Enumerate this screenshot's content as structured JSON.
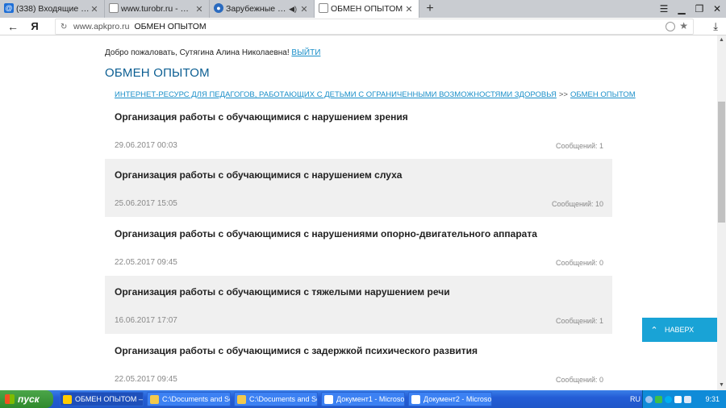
{
  "browser": {
    "tabs": [
      {
        "label": "(338) Входящие - Почта Ма",
        "icon": "mail-icon",
        "active": false
      },
      {
        "label": "www.turobr.ru - Страница",
        "icon": "page-icon",
        "active": false
      },
      {
        "label": "Зарубежные новинки",
        "icon": "globe-icon",
        "active": false
      },
      {
        "label": "ОБМЕН ОПЫТОМ",
        "icon": "page-icon",
        "active": true
      }
    ],
    "new_tab": "+",
    "address": {
      "domain": "www.apkpro.ru",
      "title": "ОБМЕН ОПЫТОМ"
    },
    "yandex_button": "Я"
  },
  "page": {
    "welcome_text": "Добро пожаловать, Сутягина Алина Николаевна!",
    "logout_link": "ВЫЙТИ",
    "heading": "ОБМЕН ОПЫТОМ",
    "breadcrumbs": {
      "root": "ИНТЕРНЕТ-РЕСУРС ДЛЯ ПЕДАГОГОВ, РАБОТАЮЩИХ С ДЕТЬМИ С ОГРАНИЧЕННЫМИ ВОЗМОЖНОСТЯМИ ЗДОРОВЬЯ",
      "separator": ">>",
      "current": "ОБМЕН ОПЫТОМ"
    },
    "topics": [
      {
        "title": "Организация работы с обучающимися с нарушением зрения",
        "date": "29.06.2017 00:03",
        "messages": "Сообщений: 1"
      },
      {
        "title": "Организация работы с обучающимися с нарушением слуха",
        "date": "25.06.2017 15:05",
        "messages": "Сообщений: 10"
      },
      {
        "title": "Организация работы с обучающимися с нарушениями опорно-двигательного аппарата",
        "date": "22.05.2017 09:45",
        "messages": "Сообщений: 0"
      },
      {
        "title": "Организация работы с обучающимися с тяжелыми нарушением речи",
        "date": "16.06.2017 17:07",
        "messages": "Сообщений: 1"
      },
      {
        "title": "Организация работы с обучающимися с задержкой психического развития",
        "date": "22.05.2017 09:45",
        "messages": "Сообщений: 0"
      }
    ],
    "to_top": "НАВЕРХ"
  },
  "taskbar": {
    "start": "пуск",
    "buttons": [
      {
        "label": "ОБМЕН ОПЫТОМ — ...",
        "active": true
      },
      {
        "label": "C:\\Documents and Se...",
        "active": false
      },
      {
        "label": "C:\\Documents and Se...",
        "active": false
      },
      {
        "label": "Документ1 - Microso...",
        "active": false
      },
      {
        "label": "Документ2 - Microso...",
        "active": false
      }
    ],
    "language": "RU",
    "clock": "9:31"
  },
  "colors": {
    "accent": "#19a3d6",
    "heading": "#0b5e92",
    "link": "#1a8fc9",
    "taskbar": "#245dd6"
  }
}
